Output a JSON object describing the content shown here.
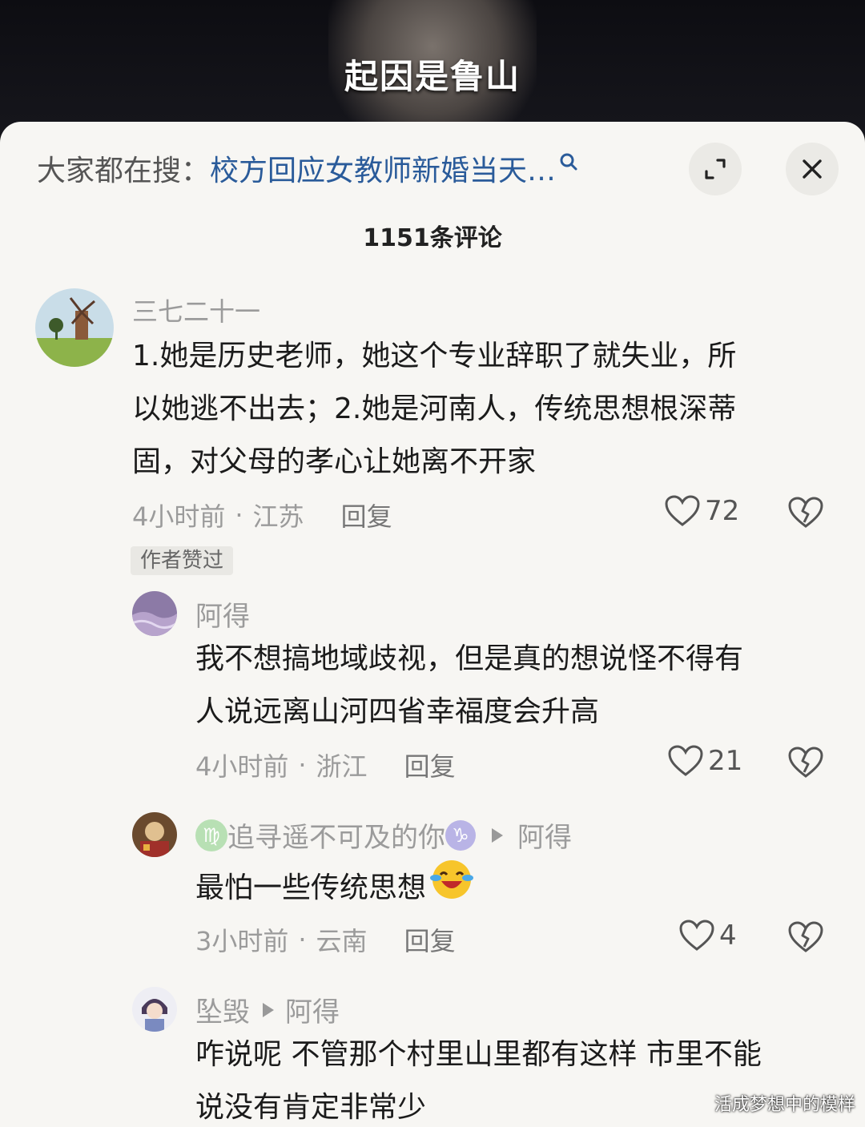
{
  "video": {
    "subtitle": "起因是鲁山"
  },
  "search_bar": {
    "prefix": "大家都在搜：",
    "query": "校方回应女教师新婚当天…"
  },
  "comment_count": "1151条评论",
  "comments": [
    {
      "username": "三七二十一",
      "text_lines": [
        "1.她是历史老师，她这个专业辞职了就失业，所",
        "以她逃不出去；2.她是河南人，传统思想根深蒂",
        "固，对父母的孝心让她离不开家"
      ],
      "time": "4小时前",
      "location": "江苏",
      "reply_label": "回复",
      "likes": "72",
      "tag": "作者赞过"
    },
    {
      "username": "阿得",
      "text_lines": [
        "我不想搞地域歧视，但是真的想说怪不得有",
        "人说远离山河四省幸福度会升高"
      ],
      "time": "4小时前",
      "location": "浙江",
      "reply_label": "回复",
      "likes": "21"
    },
    {
      "username": "追寻遥不可及的你",
      "badge_left": "♍",
      "badge_right": "♑",
      "reply_to": "阿得",
      "text": "最怕一些传统思想",
      "time": "3小时前",
      "location": "云南",
      "reply_label": "回复",
      "likes": "4"
    },
    {
      "username": "坠毁",
      "reply_to": "阿得",
      "text_lines": [
        "咋说呢 不管那个村里山里都有这样 市里不能",
        "说没有肯定非常少"
      ]
    }
  ],
  "watermark": "活成梦想中的模样",
  "colors": {
    "link_blue": "#2a5b9a",
    "sheet_bg": "#f7f6f3",
    "meta_gray": "#9b9b9b"
  }
}
